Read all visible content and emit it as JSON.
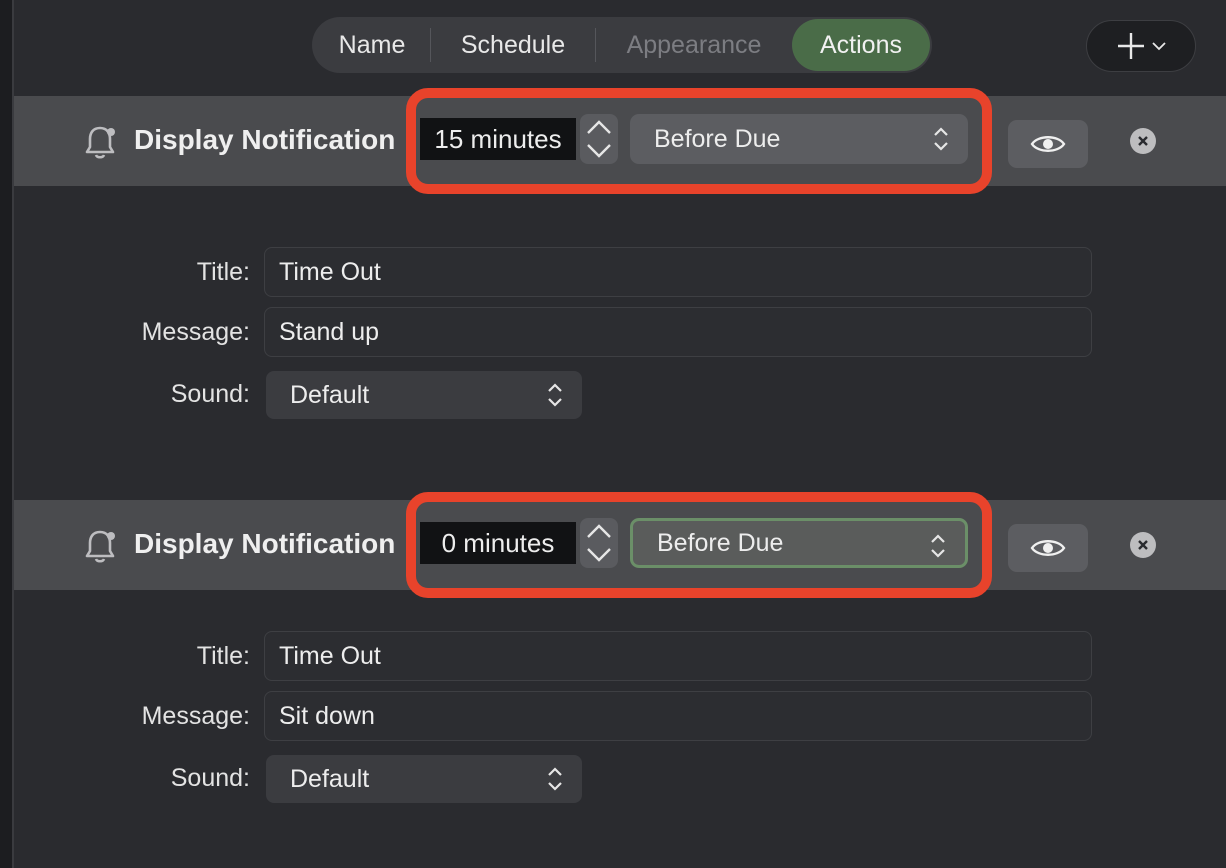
{
  "tabs": [
    {
      "label": "Name"
    },
    {
      "label": "Schedule"
    },
    {
      "label": "Appearance"
    },
    {
      "label": "Actions"
    }
  ],
  "actions": [
    {
      "title": "Display Notification",
      "offset": "15 minutes",
      "timing": "Before Due",
      "fields": {
        "title_label": "Title:",
        "title_value": "Time Out",
        "message_label": "Message:",
        "message_value": "Stand up",
        "sound_label": "Sound:",
        "sound_value": "Default"
      }
    },
    {
      "title": "Display Notification",
      "offset": "0 minutes",
      "timing": "Before Due",
      "fields": {
        "title_label": "Title:",
        "title_value": "Time Out",
        "message_label": "Message:",
        "message_value": "Sit down",
        "sound_label": "Sound:",
        "sound_value": "Default"
      }
    }
  ],
  "colors": {
    "accent_tab": "#4a6c48",
    "highlight": "#e8432b",
    "header_row": "#4a4b4e",
    "background": "#2a2b2f"
  },
  "icons": {
    "add": "plus-icon",
    "bell": "bell-icon",
    "preview": "eye-icon",
    "remove": "close-icon"
  }
}
